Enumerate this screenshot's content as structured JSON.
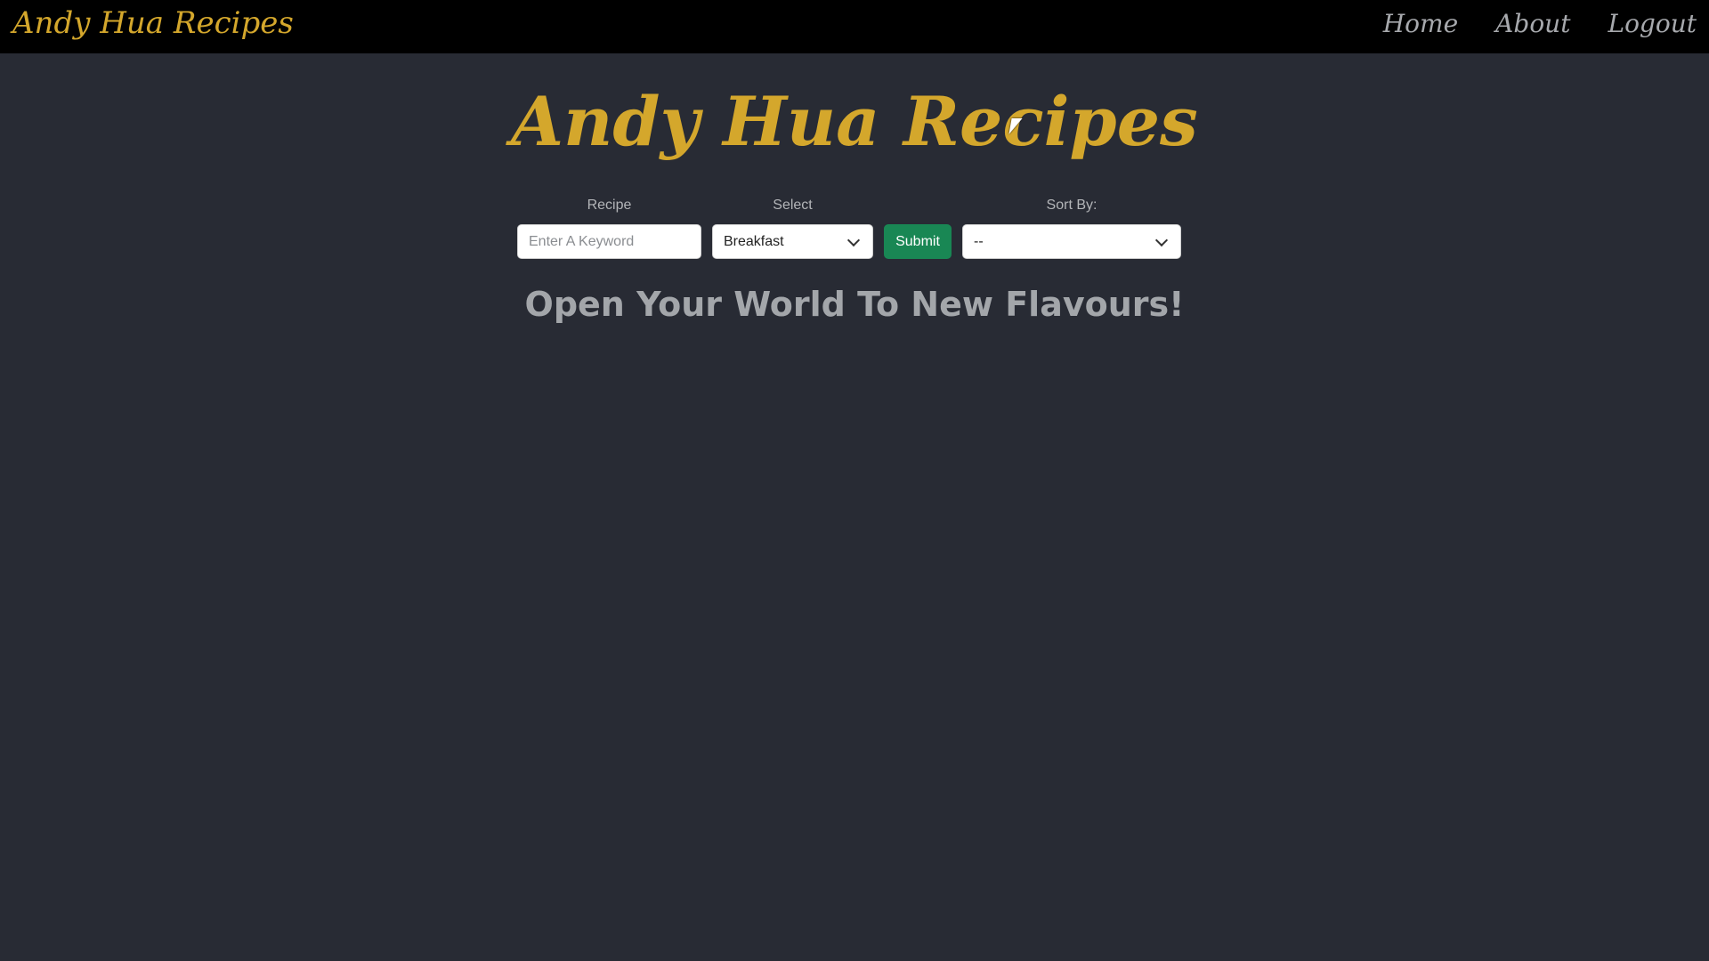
{
  "navbar": {
    "brand": "Andy Hua Recipes",
    "links": [
      "Home",
      "About",
      "Logout"
    ]
  },
  "hero": {
    "title": "Andy Hua Recipes"
  },
  "search_form": {
    "recipe_label": "Recipe",
    "recipe_placeholder": "Enter A Keyword",
    "recipe_value": "",
    "category_label": "Select",
    "category_selected": "Breakfast",
    "submit_label": "Submit",
    "sort_label": "Sort By:",
    "sort_selected": "--"
  },
  "main": {
    "tagline": "Open Your World To New Flavours!"
  },
  "colors": {
    "background": "#282b34",
    "navbar": "#000000",
    "brand_gold": "#d4a72c",
    "submit_green": "#198754",
    "muted_text": "#a3a6aa"
  }
}
